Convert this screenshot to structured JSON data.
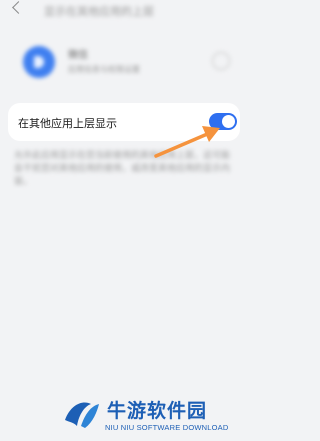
{
  "header": {
    "title": "显示在其他应用的上层"
  },
  "app": {
    "name": "微信",
    "subtitle": "应用信息与权限设置"
  },
  "setting": {
    "label": "在其他应用上层显示",
    "toggle_on": true,
    "toggle_color": "#2f6ff0"
  },
  "description": "允许此应用显示在您当前使用的其他应用上层，这可能会干扰您对其他应用的使用，或改变其他应用的显示内容。",
  "annotation": {
    "arrow_color": "#f5933d"
  },
  "watermark": {
    "cn": "牛游软件园",
    "en": "NIU NIU SOFTWARE DOWNLOAD",
    "color": "#1d5fb5"
  }
}
